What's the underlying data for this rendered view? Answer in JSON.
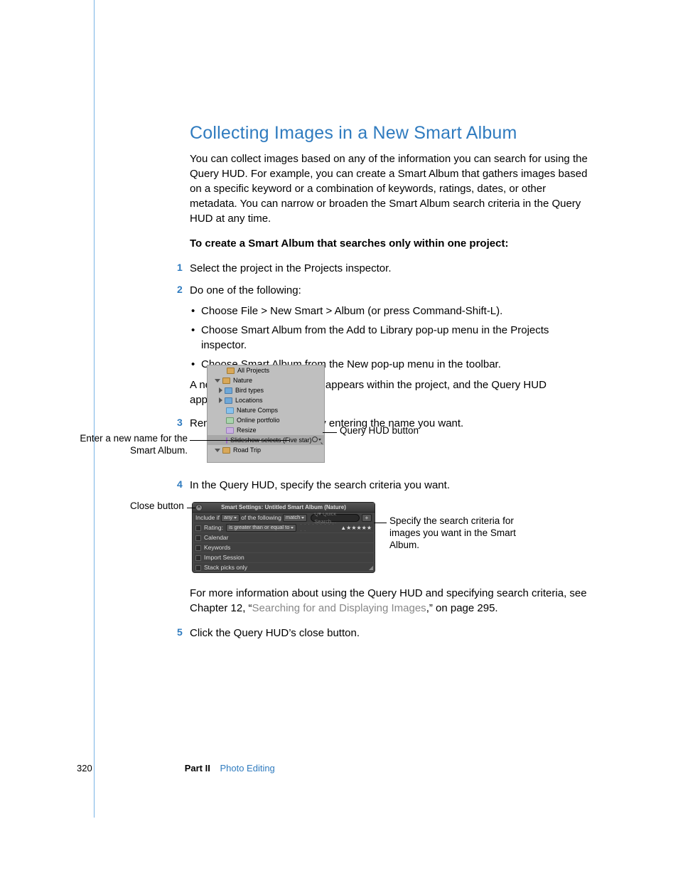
{
  "section": {
    "title": "Collecting Images in a New Smart Album",
    "intro": "You can collect images based on any of the information you can search for using the Query HUD. For example, you can create a Smart Album that gathers images based on a specific keyword or a combination of keywords, ratings, dates, or other metadata. You can narrow or broaden the Smart Album search criteria in the Query HUD at any time.",
    "task_heading": "To create a Smart Album that searches only within one project:",
    "step1": "Select the project in the Projects inspector.",
    "step2": "Do one of the following:",
    "bullets": [
      "Choose File > New Smart > Album (or press Command-Shift-L).",
      "Choose Smart Album from the Add to Library pop-up menu in the Projects inspector.",
      "Choose Smart Album from the New pop-up menu in the toolbar."
    ],
    "step2_after": "A new, untitled Smart Album appears within the project, and the Query HUD appears to its right.",
    "step3": "Rename the Smart Album by entering the name you want.",
    "step4": "In the Query HUD, specify the search criteria you want.",
    "after_fig2_a": "For more information about using the Query HUD and specifying search criteria, see Chapter 12, “",
    "after_fig2_link": "Searching for and Displaying Images",
    "after_fig2_b": ",” on page 295.",
    "step5": "Click the Query HUD’s close button."
  },
  "fig1": {
    "callout_left": "Enter a new name for the Smart Album.",
    "callout_right": "Query HUD button",
    "items": {
      "all_projects": "All Projects",
      "nature": "Nature",
      "bird_types": "Bird types",
      "locations": "Locations",
      "nature_comps": "Nature Comps",
      "online_portfolio": "Online portfolio",
      "resize": "Resize",
      "slideshow": "Slideshow selects (Five star)",
      "road_trip": "Road Trip"
    }
  },
  "fig2": {
    "callout_left": "Close button",
    "callout_right": "Specify the search criteria for images you want in the Smart Album.",
    "title": "Smart Settings: Untitled Smart Album (Nature)",
    "include_if": "Include if",
    "any": "any",
    "of_following": "of the following",
    "match": "match",
    "search_placeholder": "Q▾ Quick Search…",
    "plus": "+",
    "rating_label": "Rating:",
    "rating_op": "is greater than or equal to",
    "stars": "★★★★★",
    "calendar": "Calendar",
    "keywords": "Keywords",
    "import_session": "Import Session",
    "stack_picks": "Stack picks only"
  },
  "footer": {
    "page": "320",
    "part": "Part II",
    "section_name": "Photo Editing"
  }
}
